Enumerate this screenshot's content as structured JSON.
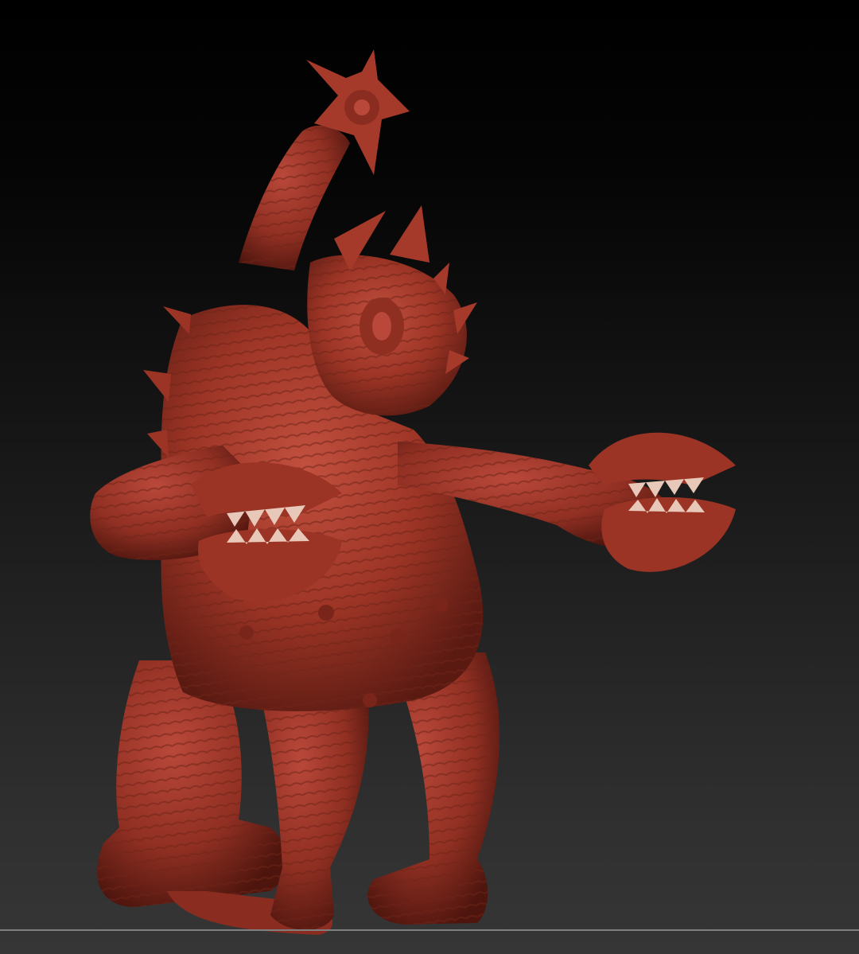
{
  "viewport": {
    "background_top": "#000000",
    "background_bottom": "#363636",
    "floor_line_color": "#7f7f7f"
  },
  "model": {
    "subject": "sculpted-kaiju-monster",
    "material_color": "#a8392c",
    "shadow_color": "#5a1a12",
    "highlight_color": "#d0685a"
  }
}
